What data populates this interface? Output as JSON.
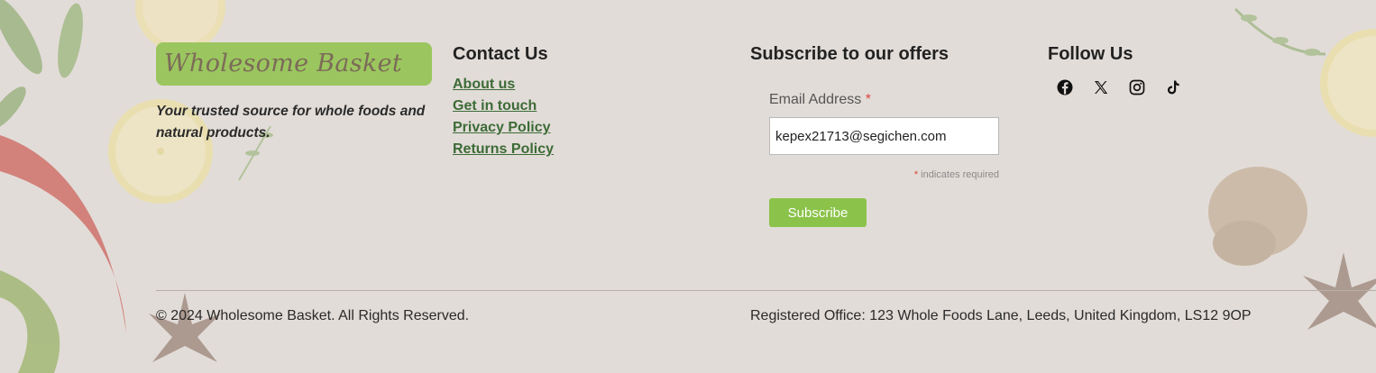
{
  "brand": {
    "logo_text": "Wholesome Basket",
    "tagline": "Your trusted source for whole foods and natural products."
  },
  "contact": {
    "heading": "Contact Us",
    "links": [
      "About us",
      "Get in touch",
      "Privacy Policy",
      "Returns Policy"
    ]
  },
  "subscribe": {
    "heading": "Subscribe to our offers",
    "email_label": "Email Address",
    "required_star": "*",
    "email_value": "kepex21713@segichen.com",
    "required_note": "indicates required",
    "button_label": "Subscribe"
  },
  "follow": {
    "heading": "Follow Us",
    "icons": [
      "facebook-icon",
      "x-icon",
      "instagram-icon",
      "tiktok-icon"
    ]
  },
  "footer": {
    "copyright": "© 2024 Wholesome Basket. All Rights Reserved.",
    "office": "Registered Office: 123 Whole Foods Lane, Leeds, United Kingdom, LS12 9OP"
  },
  "colors": {
    "background": "#e2dcd8",
    "logo_bg": "#9bc65f",
    "logo_text": "#7c6b58",
    "link": "#3c6b36",
    "button": "#8bc34a",
    "required": "#d9443c"
  }
}
